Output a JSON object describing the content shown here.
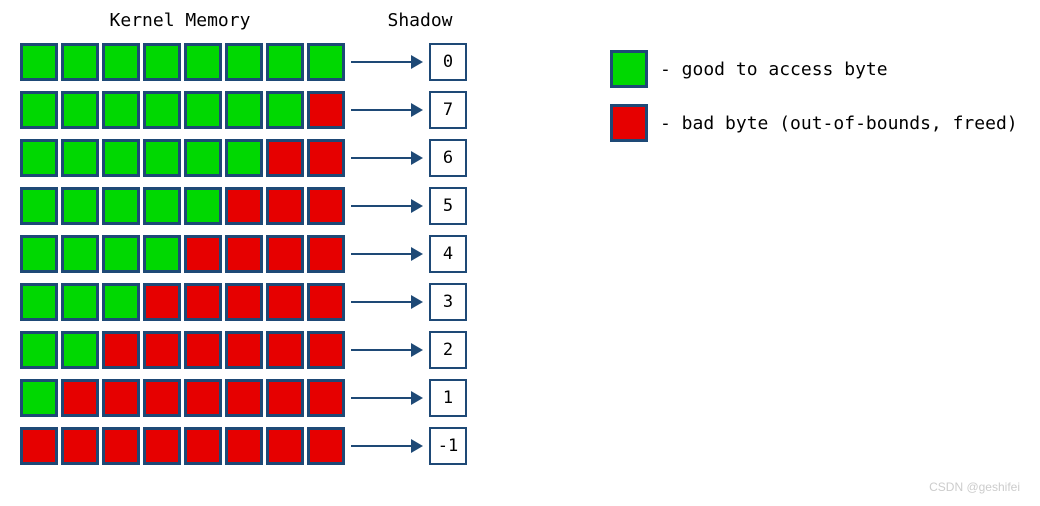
{
  "headers": {
    "kernel": "Kernel Memory",
    "shadow": "Shadow"
  },
  "rows": [
    {
      "good": 8,
      "bad": 0,
      "shadow": "0"
    },
    {
      "good": 7,
      "bad": 1,
      "shadow": "7"
    },
    {
      "good": 6,
      "bad": 2,
      "shadow": "6"
    },
    {
      "good": 5,
      "bad": 3,
      "shadow": "5"
    },
    {
      "good": 4,
      "bad": 4,
      "shadow": "4"
    },
    {
      "good": 3,
      "bad": 5,
      "shadow": "3"
    },
    {
      "good": 2,
      "bad": 6,
      "shadow": "2"
    },
    {
      "good": 1,
      "bad": 7,
      "shadow": "1"
    },
    {
      "good": 0,
      "bad": 8,
      "shadow": "-1"
    }
  ],
  "legend": {
    "good": "- good to access byte",
    "bad": "- bad byte (out-of-bounds, freed)"
  },
  "watermark": "CSDN @geshifei"
}
